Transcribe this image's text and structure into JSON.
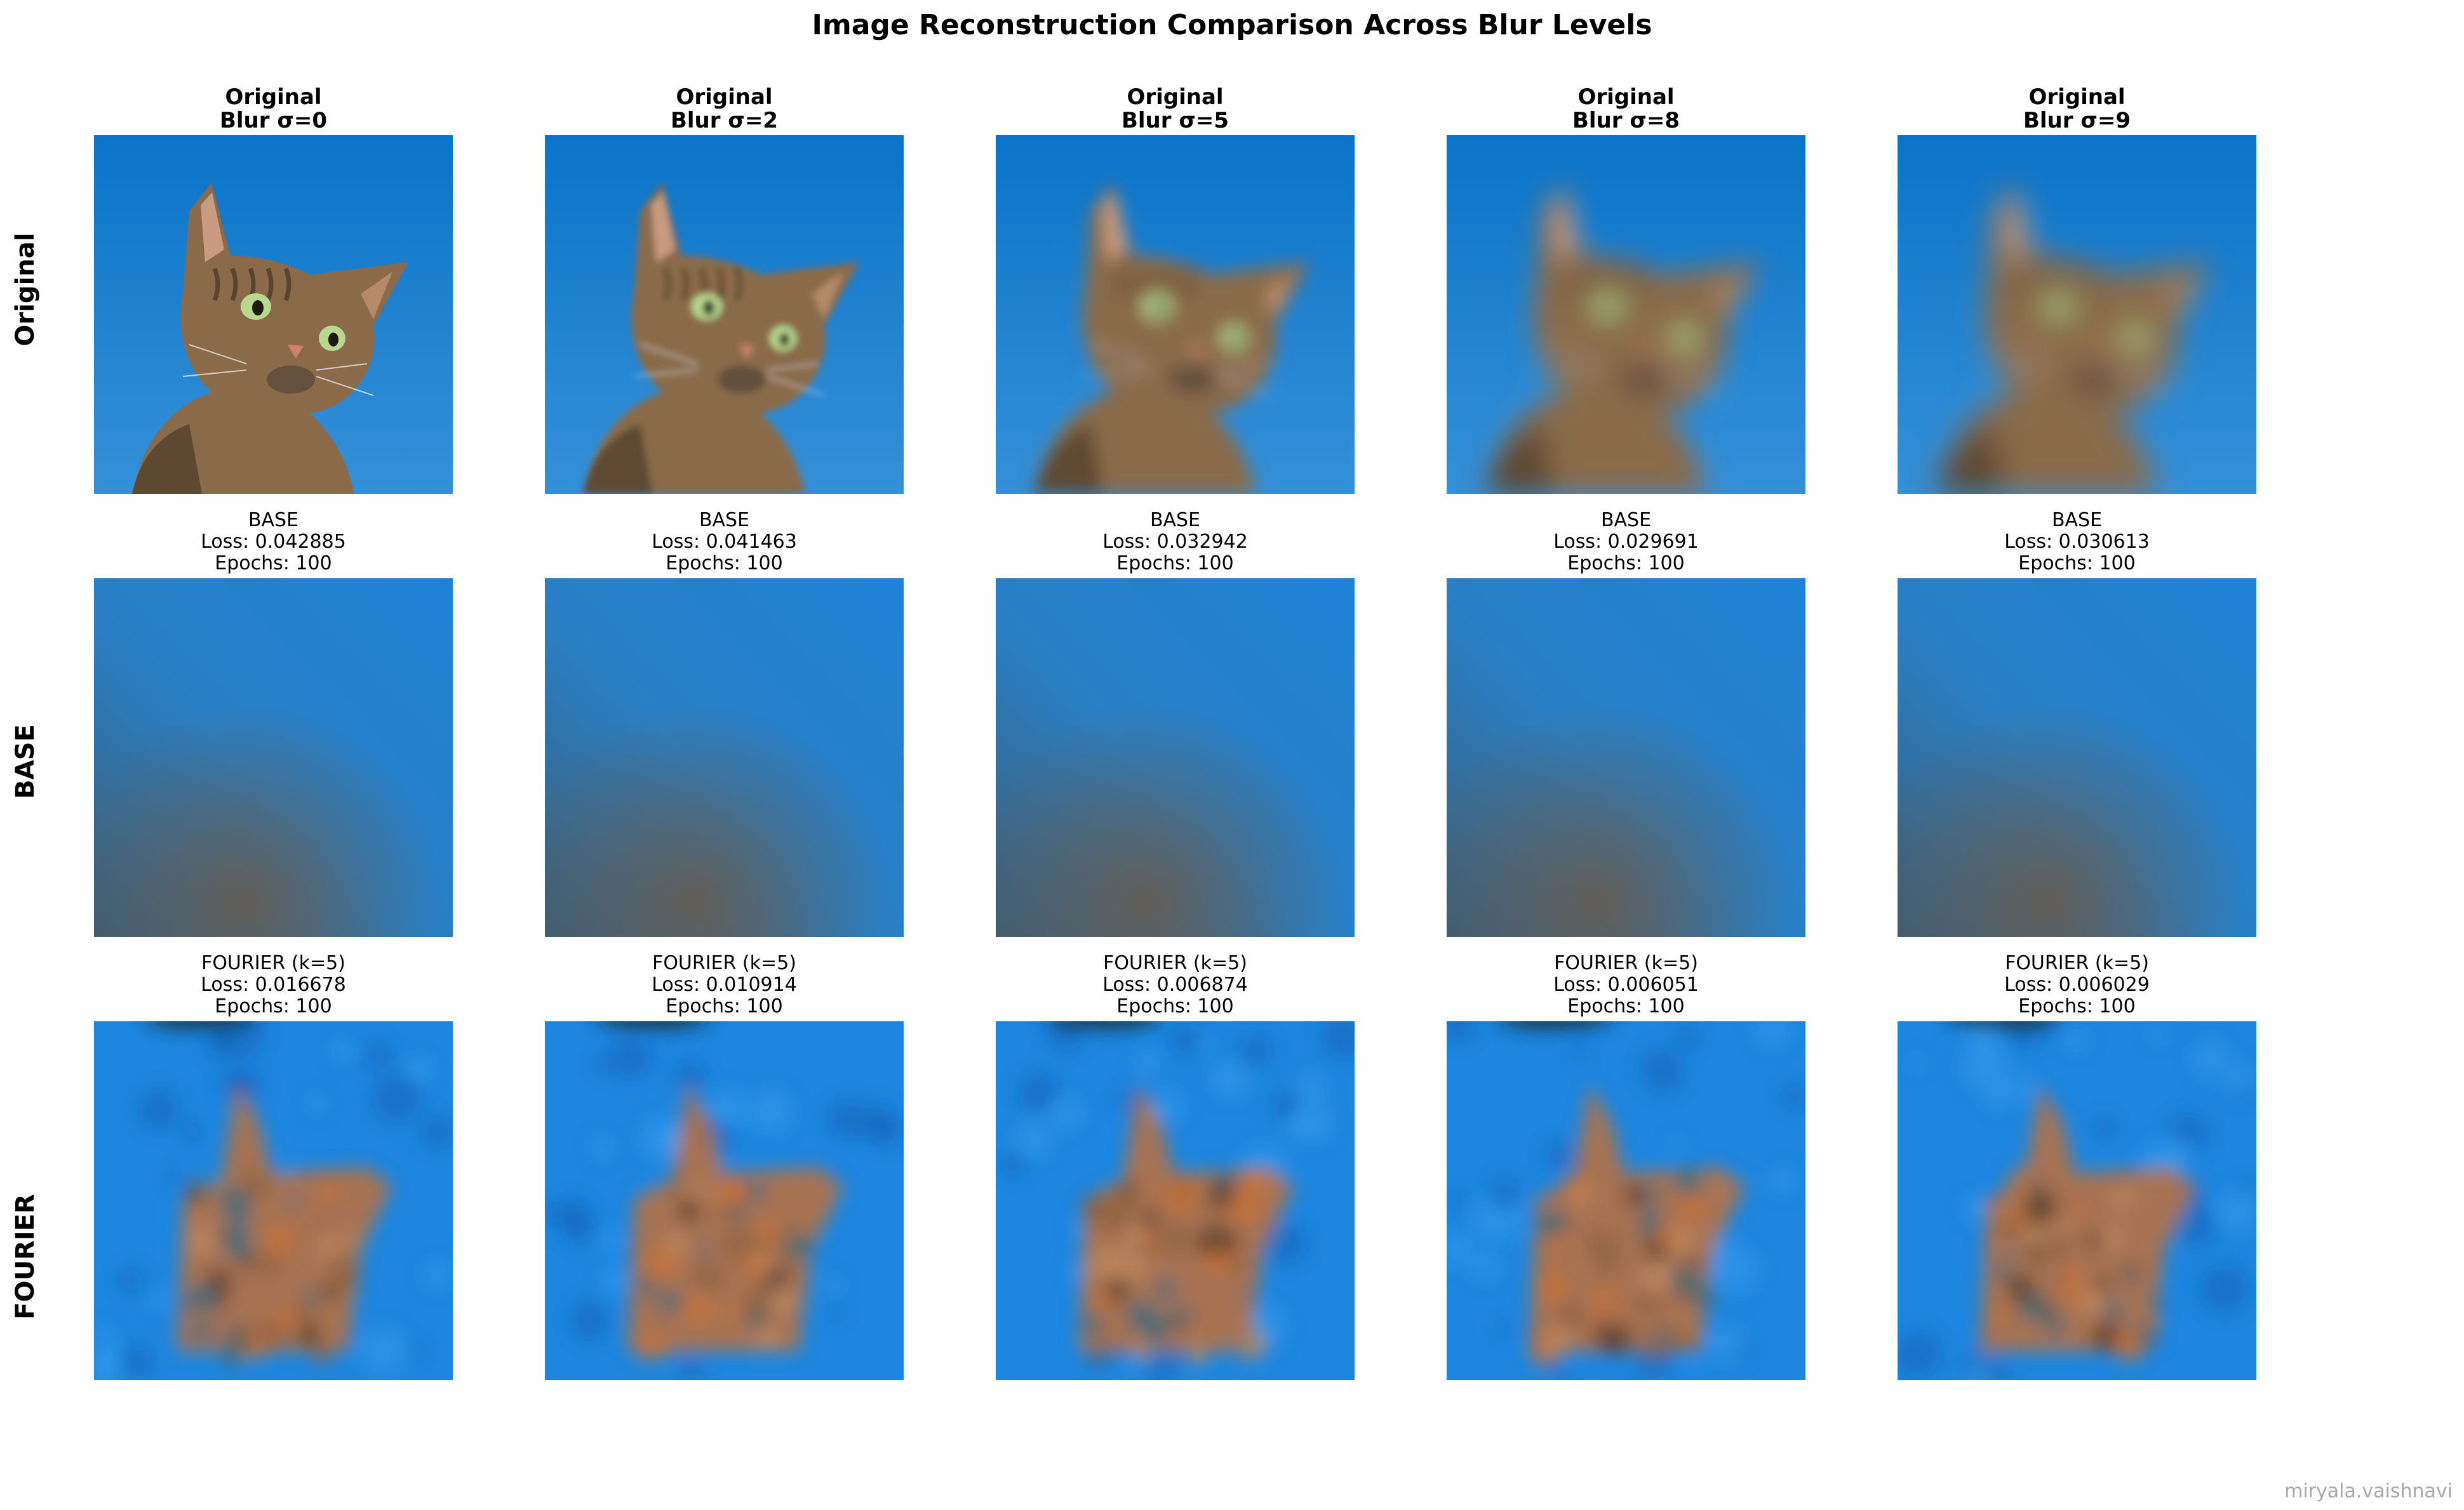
{
  "figure": {
    "title": "Image Reconstruction Comparison Across Blur Levels",
    "watermark": "miryala.vaishnavi"
  },
  "chart_data": {
    "type": "image_grid",
    "title": "Image Reconstruction Comparison Across Blur Levels",
    "rows": [
      {
        "label": "Original",
        "panels": [
          {
            "title_line1": "Original",
            "title_line2": "Blur σ=0",
            "blur_sigma": 0
          },
          {
            "title_line1": "Original",
            "title_line2": "Blur σ=2",
            "blur_sigma": 2
          },
          {
            "title_line1": "Original",
            "title_line2": "Blur σ=5",
            "blur_sigma": 5
          },
          {
            "title_line1": "Original",
            "title_line2": "Blur σ=8",
            "blur_sigma": 8
          },
          {
            "title_line1": "Original",
            "title_line2": "Blur σ=9",
            "blur_sigma": 9
          }
        ]
      },
      {
        "label": "BASE",
        "panels": [
          {
            "title_line1": "BASE",
            "title_line2": "Loss: 0.042885",
            "title_line3": "Epochs: 100",
            "loss": 0.042885,
            "epochs": 100
          },
          {
            "title_line1": "BASE",
            "title_line2": "Loss: 0.041463",
            "title_line3": "Epochs: 100",
            "loss": 0.041463,
            "epochs": 100
          },
          {
            "title_line1": "BASE",
            "title_line2": "Loss: 0.032942",
            "title_line3": "Epochs: 100",
            "loss": 0.032942,
            "epochs": 100
          },
          {
            "title_line1": "BASE",
            "title_line2": "Loss: 0.029691",
            "title_line3": "Epochs: 100",
            "loss": 0.029691,
            "epochs": 100
          },
          {
            "title_line1": "BASE",
            "title_line2": "Loss: 0.030613",
            "title_line3": "Epochs: 100",
            "loss": 0.030613,
            "epochs": 100
          }
        ]
      },
      {
        "label": "FOURIER",
        "panels": [
          {
            "title_line1": "FOURIER (k=5)",
            "title_line2": "Loss: 0.016678",
            "title_line3": "Epochs: 100",
            "loss": 0.016678,
            "epochs": 100
          },
          {
            "title_line1": "FOURIER (k=5)",
            "title_line2": "Loss: 0.010914",
            "title_line3": "Epochs: 100",
            "loss": 0.010914,
            "epochs": 100
          },
          {
            "title_line1": "FOURIER (k=5)",
            "title_line2": "Loss: 0.006874",
            "title_line3": "Epochs: 100",
            "loss": 0.006874,
            "epochs": 100
          },
          {
            "title_line1": "FOURIER (k=5)",
            "title_line2": "Loss: 0.006051",
            "title_line3": "Epochs: 100",
            "loss": 0.006051,
            "epochs": 100
          },
          {
            "title_line1": "FOURIER (k=5)",
            "title_line2": "Loss: 0.006029",
            "title_line3": "Epochs: 100",
            "loss": 0.006029,
            "epochs": 100
          }
        ]
      }
    ]
  },
  "colors": {
    "sky_top": "#0a74c8",
    "sky_bottom": "#3590d8",
    "cat_fur": "#8a6a48",
    "cat_dark": "#3a2c20",
    "eye": "#b8d890",
    "base_blue": "#2a7fc4",
    "base_brown": "#6a5a4a",
    "fourier_blue": "#1c86e0",
    "fourier_orange": "#c0703a",
    "watermark": "#a8a8a8"
  }
}
